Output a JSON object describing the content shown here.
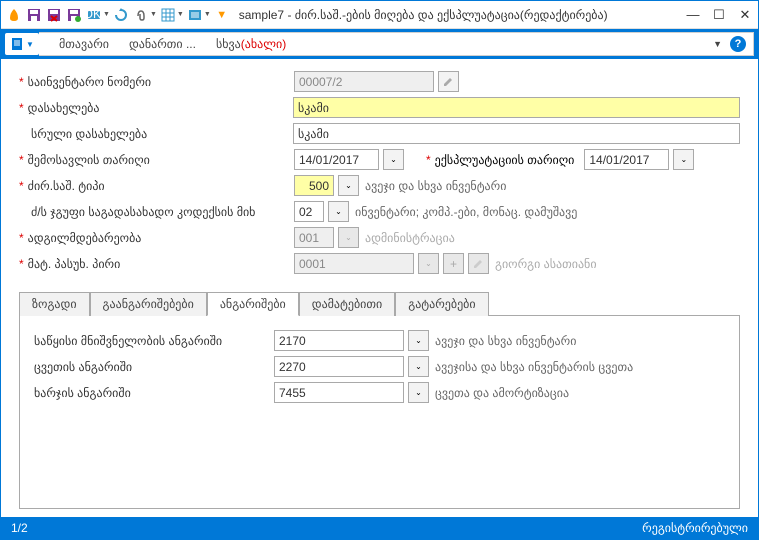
{
  "titlebar": {
    "doc_prefix": "sample7",
    "title": " - ძირ.საშ.-ების მიღება და ექსპლუატაცია(რედაქტირება)"
  },
  "menu": {
    "main": "მთავარი",
    "attachment": "დანართი ...",
    "extra": "სხვა",
    "extra_new": "(ახალი)"
  },
  "form": {
    "inv_no_label": "საინვენტარო ნომერი",
    "inv_no_value": "00007/2",
    "name_label": "დასახელება",
    "name_value": "სკამი",
    "full_name_label": "სრული დასახელება",
    "full_name_value": "სკამი",
    "income_date_label": "შემოსავლის თარიღი",
    "income_date_value": "14/01/2017",
    "exploit_date_label": "ექსპლუატაციის თარიღი",
    "exploit_date_value": "14/01/2017",
    "type_label": "ძირ.საშ. ტიპი",
    "type_value": "500",
    "type_desc": "ავეჯი და სხვა ინვენტარი",
    "tax_group_label": "ძ/ს ჯგუფი საგადასახადო კოდექსის მიხ",
    "tax_group_value": "02",
    "tax_group_desc": "ინვენტარი; კომპ.-ები, მონაც. დამუშავე",
    "loc_label": "ადგილმდებარეობა",
    "loc_value": "001",
    "loc_desc": "ადმინისტრაცია",
    "resp_label": "მატ. პასუხ. პირი",
    "resp_value": "0001",
    "resp_desc": "გიორგი ასათიანი"
  },
  "tabs": {
    "t1": "ზოგადი",
    "t2": "გაანგარიშებები",
    "t3": "ანგარიშები",
    "t4": "დამატებითი",
    "t5": "გატარებები"
  },
  "accounts": {
    "init_label": "საწყისი მნიშვნელობის ანგარიში",
    "init_value": "2170",
    "init_desc": "ავეჯი და სხვა ინვენტარი",
    "depr_label": "ცვეთის ანგარიში",
    "depr_value": "2270",
    "depr_desc": "ავეჯისა და სხვა ინვენტარის ცვეთა",
    "exp_label": "ხარჯის ანგარიში",
    "exp_value": "7455",
    "exp_desc": "ცვეთა და ამორტიზაცია"
  },
  "status": {
    "page": "1/2",
    "state": "რეგისტრირებული"
  }
}
